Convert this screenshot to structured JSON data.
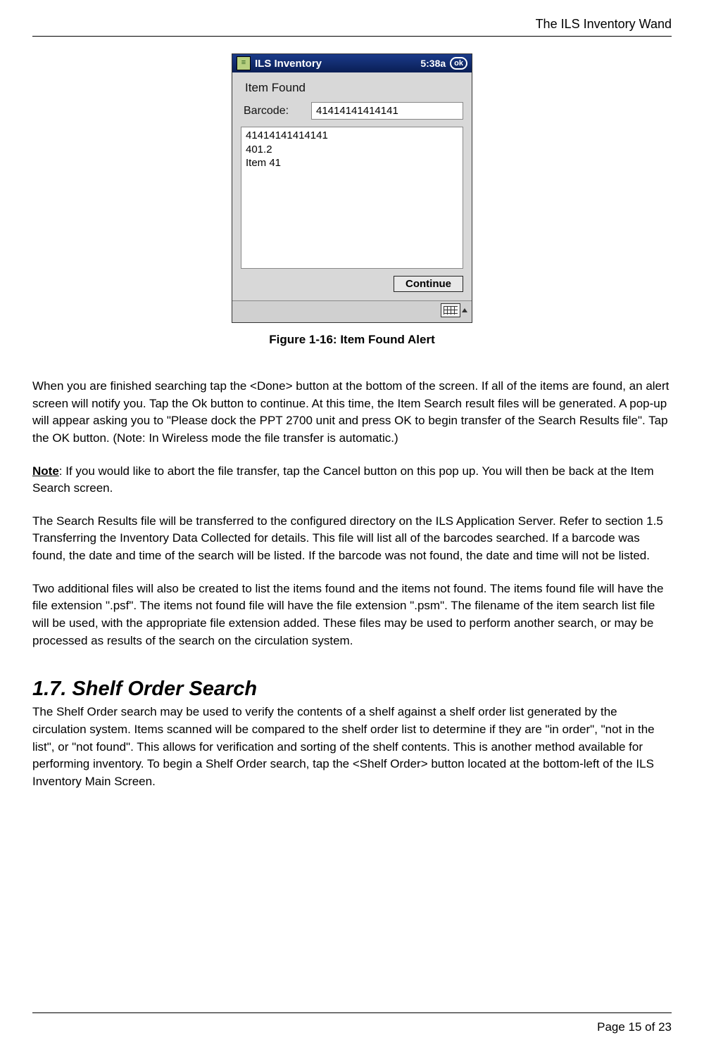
{
  "header": {
    "running_title": "The ILS Inventory Wand"
  },
  "device": {
    "titlebar": {
      "app_name": "ILS Inventory",
      "time": "5:38a",
      "ok_label": "ok"
    },
    "panel_heading": "Item Found",
    "barcode_label": "Barcode:",
    "barcode_value": "41414141414141",
    "result_text": "41414141414141\n401.2\nItem 41",
    "continue_label": "Continue"
  },
  "figure_caption": "Figure 1-16: Item Found Alert",
  "paragraphs": {
    "p1": "When you are finished searching tap the <Done> button at the bottom of the screen. If all of the items are found, an alert screen will notify you. Tap the Ok button to continue. At this time, the Item Search result files will be generated. A pop-up will appear asking you to \"Please dock the PPT 2700 unit and press OK to begin transfer of the Search Results file\". Tap the OK button. (Note: In Wireless mode the file transfer is automatic.)",
    "note_label": "Note",
    "note_body": ":  If you would like to abort the file transfer, tap the Cancel button on this pop up.  You will then be back at the Item Search screen.",
    "p3": "The Search Results file will be transferred to the configured directory on the ILS Application Server.  Refer to section 1.5  Transferring the Inventory Data Collected for details. This file will list all of the barcodes searched. If a barcode was found, the date and time of the search will be listed.  If the barcode was not found, the date and time will not be listed.",
    "p4": "Two additional files will also be created to list the items found and the items not found. The items found file will have the file extension \".psf\". The items not found file will have the file extension \".psm\". The filename of the item search list file will be used, with the appropriate file extension added. These files may be used to perform another search, or may be processed as results of the search on the circulation system."
  },
  "section": {
    "heading": "1.7.  Shelf Order Search",
    "body": "The Shelf Order search may be used to verify the contents of a shelf against a shelf order list generated by the circulation system. Items scanned will be compared to the shelf order list to determine if they are \"in order\", \"not in the list\", or \"not found\". This allows for verification and sorting of the shelf contents. This is another method available for performing inventory.  To begin a Shelf Order search, tap the <Shelf Order> button located at the bottom-left of the ILS Inventory Main Screen."
  },
  "footer": {
    "page_label": "Page 15 of 23"
  }
}
